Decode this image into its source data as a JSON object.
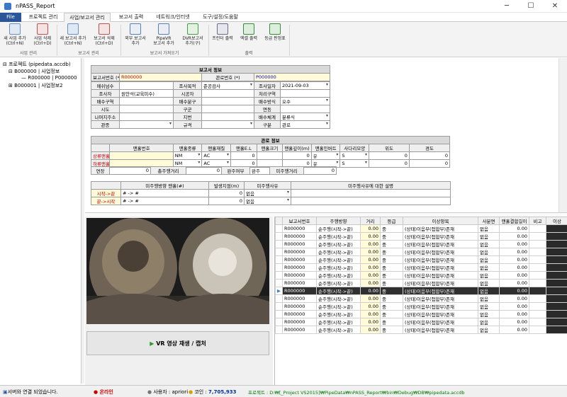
{
  "window": {
    "title": "nPASS_Report",
    "min": "─",
    "max": "☐",
    "close": "✕"
  },
  "tabs": [
    "File",
    "프로젝트 관리",
    "사업/보고서 관리",
    "보고서 출력",
    "네트워크/인터넷",
    "도구/설정/도움말"
  ],
  "ribbon": {
    "buttons": [
      {
        "label1": "새 사업 추가",
        "label2": "(Ctrl+N)"
      },
      {
        "label1": "사업 삭제",
        "label2": "(Ctrl+D)"
      },
      {
        "label1": "새 보고서 추가",
        "label2": "(Ctrl+N)"
      },
      {
        "label1": "보고서 삭제",
        "label2": "(Ctrl+D)"
      },
      {
        "label1": "외부 보고서",
        "label2": "추가"
      },
      {
        "label1": "PipeVR",
        "label2": "보고서 추가"
      },
      {
        "label1": "DVR보고서",
        "label2": "추가(구)"
      },
      {
        "label1": "프린터 출력",
        "label2": ""
      },
      {
        "label1": "엑셀 출력",
        "label2": ""
      },
      {
        "label1": "등급 판정표",
        "label2": ""
      }
    ],
    "groups": [
      "사업 관리",
      "보고서 관리",
      "보고서 가져오기",
      "출력"
    ]
  },
  "tree": {
    "root": "프로젝트 (pipedata.accdb)",
    "b1": "B000000 | 사업정보",
    "r1": "R000000 | P000000",
    "b2": "B000001 | 사업정보2"
  },
  "report": {
    "title": "보고서 정보",
    "report_no_label": "보고서번호 (*)",
    "report_no": "R000000",
    "pipe_no_label": "관로번호 (*)",
    "pipe_no": "P000000",
    "mesh_label": "메쉬넘수",
    "purpose_label": "조사목적",
    "purpose": "준공검사",
    "date_label": "조사일자",
    "date": "2021-09-03",
    "surveyor_label": "조사자",
    "surveyor": "원안석(교육미수)",
    "contractor_label": "시공자",
    "processor_label": "처리구역",
    "drain_area_label": "배수구역",
    "drain_sub_label": "배수분구",
    "drain_method_label": "배수방식",
    "drain_method": "오수",
    "city_label": "시도",
    "district_label": "구군",
    "town_label": "면동",
    "address_label": "나머지주소",
    "lot_label": "지번",
    "drain_sys_label": "배수체계",
    "drain_sys": "분류식",
    "pipe_kind_label": "관종",
    "spec_label": "규격",
    "section_label": "구분",
    "section": "관로"
  },
  "pipe": {
    "title": "관로 정보",
    "headers": [
      "맨홀번호",
      "맨홀종류",
      "맨홀재질",
      "맨홀E.L",
      "맨홀크기",
      "맨홀깊이(m)",
      "맨홀인버트",
      "사다리모양",
      "위도",
      "경도"
    ],
    "up_label": "상류맨홀",
    "down_label": "하류맨홀",
    "up": {
      "type": "NM",
      "mat": "AC",
      "el": "0",
      "depth": "0",
      "invert": "유",
      "ladder": "S",
      "lat": "0",
      "lon": "0"
    },
    "down": {
      "type": "NM",
      "mat": "AC",
      "el": "0",
      "depth": "0",
      "invert": "유",
      "ladder": "S",
      "lat": "0",
      "lon": "0"
    },
    "ext_label": "연장",
    "ext": "0",
    "total_label": "총주행거리",
    "total": "0",
    "done_label": "완주여부",
    "done": "완주",
    "incomplete_label": "미주행거리",
    "incomplete": "0"
  },
  "direction": {
    "h1": "미주행방향 맨홀(#)",
    "h2": "발생지점(m)",
    "h3": "미주행사유",
    "h4": "미주행사유에 대한 설명",
    "row1_label": "시작->끝",
    "row1_val": "# -> #",
    "row1_pos": "0",
    "row1_reason": "없음",
    "row2_label": "끝->시작",
    "row2_val": "# -> #",
    "row2_pos": "0",
    "row2_reason": "없음"
  },
  "video": {
    "play_label": "VR 영상 재생 / 캡처",
    "play_icon": "▶"
  },
  "grid": {
    "headers": [
      "보고서번호",
      "주행방향",
      "거리",
      "등급",
      "이상항목",
      "사분면",
      "맨홀결합길이",
      "비고",
      "이상"
    ],
    "rows": [
      [
        "R000000",
        "순주행(시작->끝)",
        "0.00",
        "중",
        "(상태)이음부(접합부)존재",
        "없음",
        "0.00"
      ],
      [
        "R000000",
        "순주행(시작->끝)",
        "0.00",
        "중",
        "(상태)이음부(접합부)존재",
        "없음",
        "0.00"
      ],
      [
        "R000000",
        "순주행(시작->끝)",
        "0.00",
        "중",
        "(상태)이음부(접합부)존재",
        "없음",
        "0.00"
      ],
      [
        "R000000",
        "순주행(시작->끝)",
        "0.00",
        "중",
        "(상태)이음부(접합부)존재",
        "없음",
        "0.00"
      ],
      [
        "R000000",
        "순주행(시작->끝)",
        "0.00",
        "중",
        "(상태)이음부(접합부)존재",
        "없음",
        "0.00"
      ],
      [
        "R000000",
        "순주행(시작->끝)",
        "0.00",
        "중",
        "(상태)이음부(접합부)존재",
        "없음",
        "0.00"
      ],
      [
        "R000000",
        "순주행(시작->끝)",
        "0.00",
        "중",
        "(상태)이음부(접합부)존재",
        "없음",
        "0.00"
      ],
      [
        "R000000",
        "순주행(시작->끝)",
        "0.00",
        "중",
        "(상태)이음부(접합부)존재",
        "없음",
        "0.00"
      ],
      [
        "R000000",
        "순주행(시작->끝)",
        "0.00",
        "중",
        "(상태)이음부(접합부)존재",
        "없음",
        "0.00"
      ],
      [
        "R000000",
        "순주행(시작->끝)",
        "0.00",
        "중",
        "(상태)이음부(접합부)존재",
        "없음",
        "0.00"
      ],
      [
        "R000000",
        "순주행(시작->끝)",
        "0.00",
        "중",
        "(상태)이음부(접합부)존재",
        "없음",
        "0.00"
      ],
      [
        "R000000",
        "순주행(시작->끝)",
        "0.00",
        "중",
        "(상태)이음부(접합부)존재",
        "없음",
        "0.00"
      ],
      [
        "R000000",
        "순주행(시작->끝)",
        "0.00",
        "중",
        "(상태)이음부(접합부)존재",
        "없음",
        "0.00"
      ],
      [
        "R000000",
        "순주행(시작->끝)",
        "0.00",
        "중",
        "(상태)이음부(접합부)존재",
        "없음",
        "0.00"
      ]
    ],
    "selected_index": 8
  },
  "status": {
    "connection": "서버와 연결 되었습니다.",
    "online": "온라인",
    "user_label": "사용자 : apriori",
    "coin_label": "코인 :",
    "coin": "7,705,933",
    "project": "프로젝트 : D:₩[_Project VS2015]₩PipeData₩nPASS_Report₩bin₩Debug₩DB₩pipedata.accdb"
  },
  "colors": {
    "accent": "#2b579a",
    "required": "#c00000",
    "yellow": "#fffbd8",
    "online": "#d00000",
    "coin": "#0030a0",
    "project": "#007a00"
  }
}
